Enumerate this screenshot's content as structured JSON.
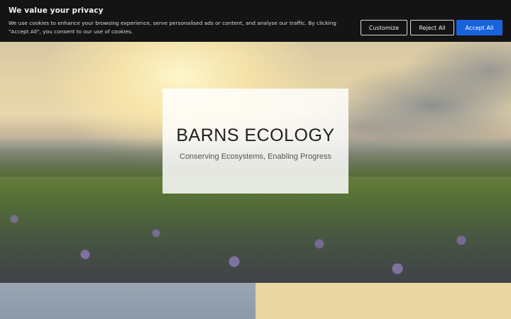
{
  "cookie_banner": {
    "title": "We value your privacy",
    "text": "We use cookies to enhance your browsing experience, serve personalised ads or content, and analyse our traffic. By clicking \"Accept All\", you consent to our use of cookies.",
    "buttons": {
      "customize": "Customize",
      "reject": "Reject All",
      "accept": "Accept All"
    },
    "accent_color": "#1863dc",
    "background_color": "#141414"
  },
  "hero": {
    "title": "BARNS ECOLOGY",
    "subtitle": "Conserving Ecosystems, Enabling Progress"
  },
  "panels": {
    "right_color": "#ead6a2"
  }
}
